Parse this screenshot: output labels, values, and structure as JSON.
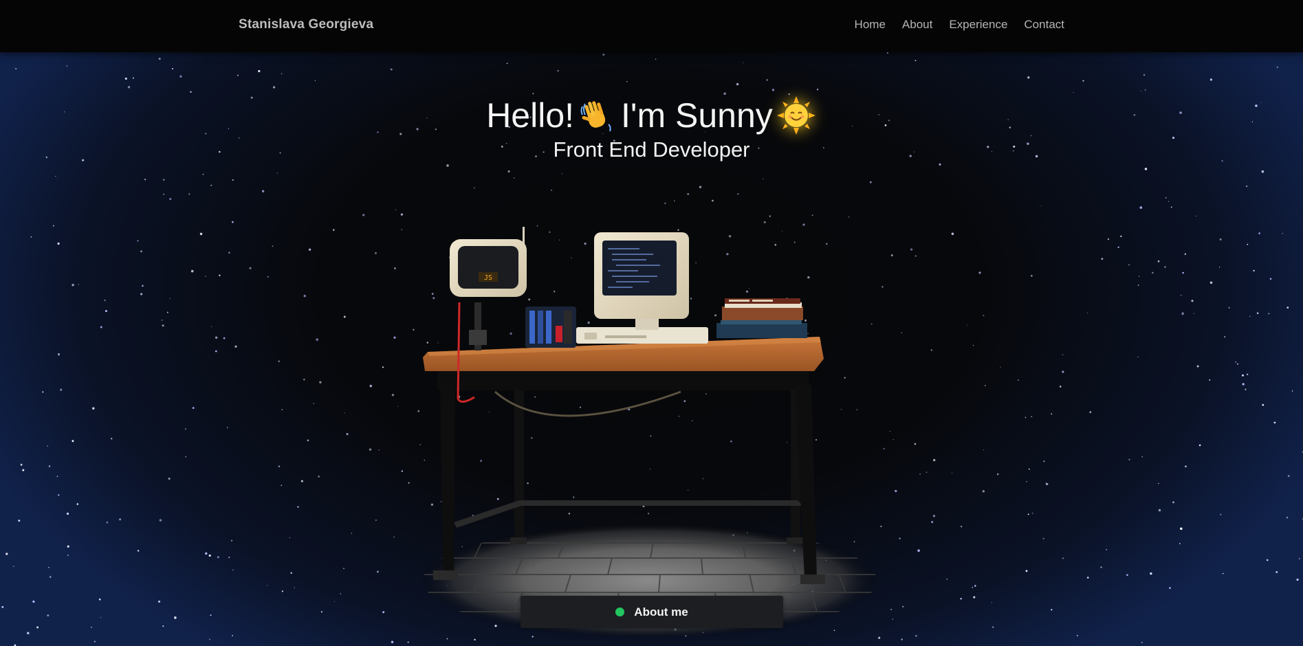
{
  "navbar": {
    "brand": "Stanislava Georgieva",
    "links": [
      "Home",
      "About",
      "Experience",
      "Contact"
    ]
  },
  "hero": {
    "greeting": "Hello!",
    "name_text": "I'm Sunny",
    "subtitle": "Front End Developer",
    "icons": [
      "waving-hand-icon",
      "smiling-sun-icon"
    ]
  },
  "scene": {
    "monitor_screen_text": "JS"
  },
  "cta": {
    "label": "About me",
    "status_color": "#22c55e"
  },
  "colors": {
    "background": "#07080a",
    "edge_glow": "#10214a",
    "navbar": "#050505",
    "accent_sun": "#ffd22a",
    "desk_wood": "#b8692c"
  }
}
